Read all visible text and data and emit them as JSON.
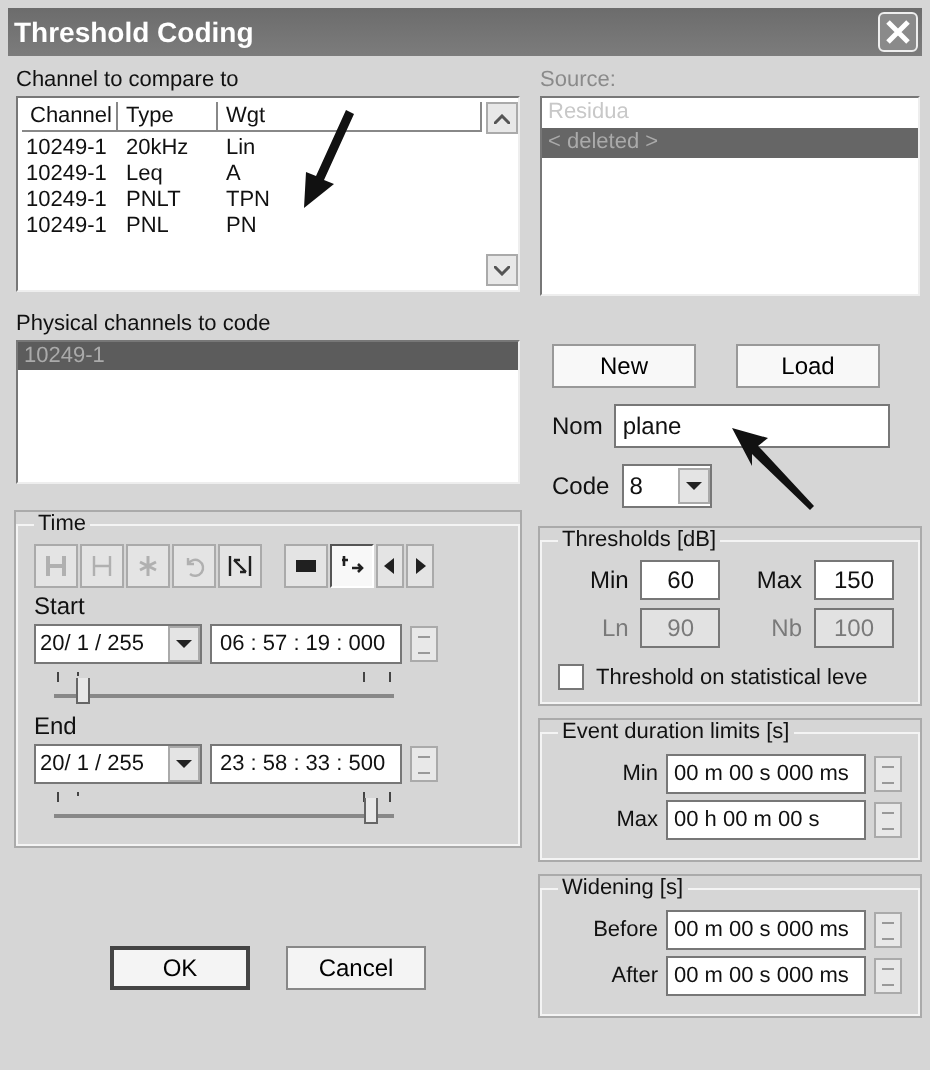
{
  "window": {
    "title": "Threshold Coding"
  },
  "compare": {
    "label": "Channel to compare to",
    "columns": [
      "Channel",
      "Type",
      "Wgt"
    ],
    "rows": [
      [
        "10249-1",
        "20kHz",
        "Lin"
      ],
      [
        "10249-1",
        "Leq",
        "A"
      ],
      [
        "10249-1",
        "PNLT",
        "TPN"
      ],
      [
        "10249-1",
        "PNL",
        "PN"
      ]
    ]
  },
  "source": {
    "label": "Source:",
    "disabled": true,
    "items": [
      {
        "text": "Residua",
        "selected": false
      },
      {
        "text": "< deleted >",
        "selected": true
      }
    ]
  },
  "physical": {
    "label": "Physical channels to code",
    "items": [
      {
        "text": "10249-1",
        "selected": true
      }
    ]
  },
  "time": {
    "label": "Time",
    "tools": [
      {
        "kind": "first",
        "disabled": true,
        "selected": false
      },
      {
        "kind": "last",
        "disabled": true,
        "selected": false
      },
      {
        "kind": "marker",
        "disabled": true,
        "selected": false
      },
      {
        "kind": "undo",
        "disabled": true,
        "selected": false
      },
      {
        "kind": "fit",
        "disabled": false,
        "selected": false
      },
      {
        "kind": "view",
        "disabled": false,
        "selected": false
      },
      {
        "kind": "cursor",
        "disabled": false,
        "selected": true
      },
      {
        "kind": "prev",
        "disabled": false,
        "selected": false
      },
      {
        "kind": "next",
        "disabled": false,
        "selected": false
      }
    ],
    "ranges": [
      {
        "label": "Start",
        "date": "20/ 1 / 255",
        "time": "06 : 57 : 19 : 000",
        "level": 0.08
      },
      {
        "label": "End",
        "date": "20/ 1 / 255",
        "time": "23 : 58 : 33 : 500",
        "level": 0.93
      }
    ]
  },
  "new_button": "New",
  "load_button": "Load",
  "nom": {
    "label": "Nom",
    "value": "plane"
  },
  "code": {
    "label": "Code",
    "value": "8"
  },
  "thresholds": {
    "label": "Thresholds [dB]",
    "fields": [
      {
        "label": "Min",
        "value": "60",
        "disabled": false
      },
      {
        "label": "Max",
        "value": "150",
        "disabled": false
      },
      {
        "label": "Ln",
        "value": "90",
        "disabled": true
      },
      {
        "label": "Nb",
        "value": "100",
        "disabled": true
      }
    ],
    "checkbox": {
      "label": "Threshold on statistical leve",
      "checked": false
    }
  },
  "event_limits": {
    "label": "Event duration limits [s]",
    "fields": [
      {
        "label": "Min",
        "value": "00 m 00 s  000 ms"
      },
      {
        "label": "Max",
        "value": "00 h 00 m 00 s"
      }
    ]
  },
  "widening": {
    "label": "Widening [s]",
    "fields": [
      {
        "label": "Before",
        "value": "00 m 00 s  000 ms"
      },
      {
        "label": "After",
        "value": "00 m 00 s  000 ms"
      }
    ]
  },
  "ok_button": "OK",
  "cancel_button": "Cancel"
}
